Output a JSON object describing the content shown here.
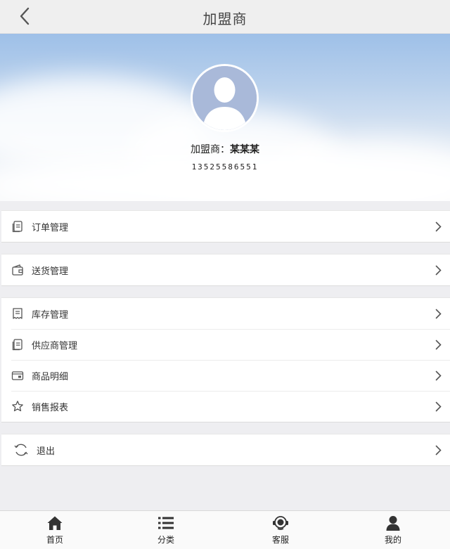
{
  "header": {
    "title": "加盟商"
  },
  "profile": {
    "name_label": "加盟商：",
    "name_value": "某某某",
    "phone": "13525586551"
  },
  "menu": {
    "group1": [
      {
        "label": "订单管理",
        "icon": "document-icon"
      }
    ],
    "group2": [
      {
        "label": "送货管理",
        "icon": "wallet-icon"
      }
    ],
    "group3": [
      {
        "label": "库存管理",
        "icon": "receipt-icon"
      },
      {
        "label": "供应商管理",
        "icon": "document-icon"
      },
      {
        "label": "商品明细",
        "icon": "card-icon"
      },
      {
        "label": "销售报表",
        "icon": "star-icon"
      }
    ],
    "group4": [
      {
        "label": "退出",
        "icon": "refresh-icon"
      }
    ]
  },
  "tabbar": [
    {
      "label": "首页",
      "icon": "home-icon"
    },
    {
      "label": "分类",
      "icon": "list-icon"
    },
    {
      "label": "客服",
      "icon": "headset-icon"
    },
    {
      "label": "我的",
      "icon": "user-icon"
    }
  ],
  "colors": {
    "background": "#eeeef1",
    "header_bg": "#efefef",
    "text": "#333333",
    "avatar_bg": "#a8b8d8"
  }
}
